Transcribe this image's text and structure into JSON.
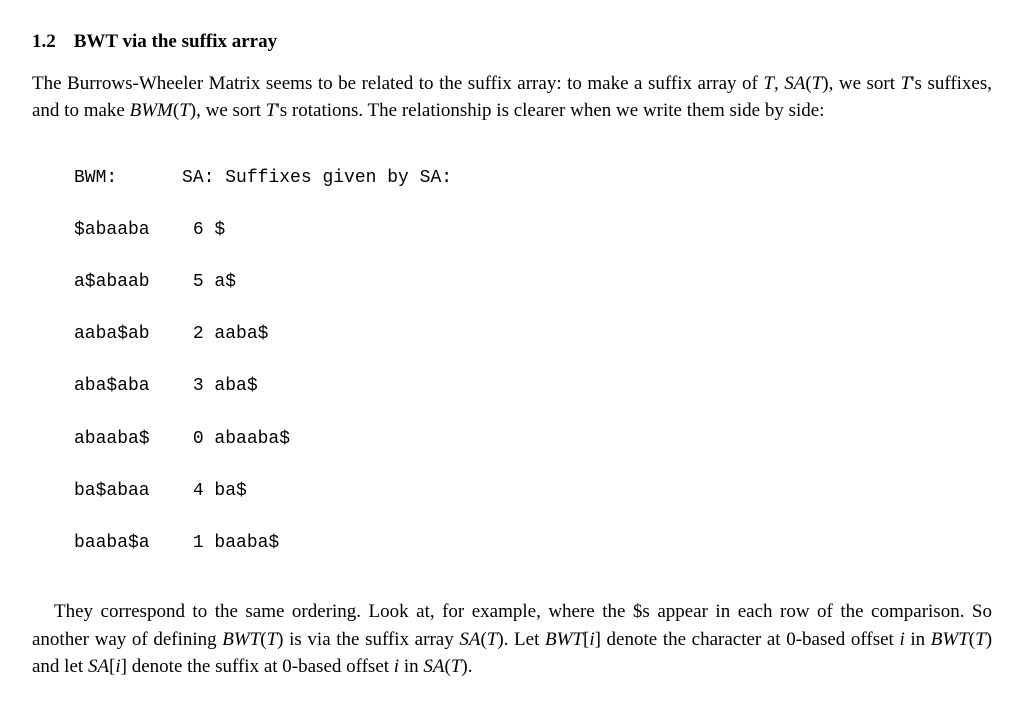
{
  "section": {
    "number": "1.2",
    "title": "BWT via the suffix array"
  },
  "para1": {
    "t1": "The Burrows-Wheeler Matrix seems to be related to the suffix array: to make a suffix array of ",
    "Tsym": "T",
    "t2": ", ",
    "SA_T": "SA",
    "lp": "(",
    "Tsym2": "T",
    "rp": ")",
    "t3": ", we sort ",
    "Tsym3": "T",
    "t4": "'s suffixes, and to make ",
    "BWM": "BWM",
    "lp2": "(",
    "Tsym4": "T",
    "rp2": ")",
    "t5": ", we sort ",
    "Tsym5": "T",
    "t6": "'s rotations.  The relationship is clearer when we write them side by side:"
  },
  "table": {
    "header": "BWM:      SA: Suffixes given by SA:",
    "rows": [
      "$abaaba    6 $",
      "a$abaab    5 a$",
      "aaba$ab    2 aaba$",
      "aba$aba    3 aba$",
      "abaaba$    0 abaaba$",
      "ba$abaa    4 ba$",
      "baaba$a    1 baaba$"
    ]
  },
  "para2": {
    "t1": "They correspond to the same ordering. Look at, for example, where the $s appear in each row of the comparison. So another way of defining ",
    "BWT": "BWT",
    "lp": "(",
    "T": "T",
    "rp": ")",
    "t2": " is via the suffix array ",
    "SA": "SA",
    "lp2": "(",
    "T2": "T",
    "rp2": ")",
    "t3": ". Let ",
    "BWT2": "BWT",
    "lb": "[",
    "i": "i",
    "rb": "]",
    "t4": " denote the character at 0-based offset ",
    "i2": "i",
    "t5": " in ",
    "BWT3": "BWT",
    "lp3": "(",
    "T3": "T",
    "rp3": ")",
    "t6": " and let ",
    "SA2": "SA",
    "lb2": "[",
    "i3": "i",
    "rb2": "]",
    "t7": " denote the suffix at 0-based offset ",
    "i4": "i",
    "t8": " in ",
    "SA3": "SA",
    "lp4": "(",
    "T4": "T",
    "rp4": ")",
    "t9": "."
  }
}
